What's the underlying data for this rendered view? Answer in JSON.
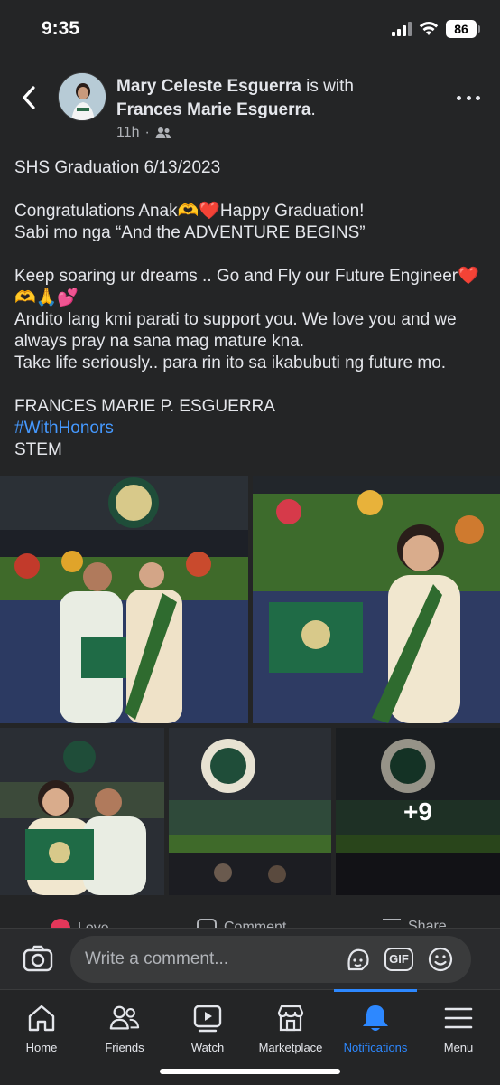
{
  "status_bar": {
    "time": "9:35",
    "battery": "86"
  },
  "post": {
    "author": "Mary Celeste Esguerra",
    "with_text": "is with",
    "tagged": "Frances Marie Esguerra",
    "tagged_suffix": ".",
    "time_ago": "11h",
    "dot": "·",
    "audience_icon": "friends-icon",
    "text": {
      "line1": "SHS Graduation 6/13/2023",
      "line2": "Congratulations Anak🫶❤️Happy Graduation!",
      "line3": "Sabi mo nga “And the ADVENTURE BEGINS”",
      "line4": "Keep soaring ur dreams .. Go and Fly our Future Engineer❤️🫶🙏💕",
      "line5": "Andito lang kmi parati to support you. We love you and we always pray na sana mag mature kna.",
      "line6": "Take life seriously.. para rin ito sa ikabubuti ng future mo.",
      "line7": "FRANCES MARIE P. ESGUERRA",
      "hashtag": "#WithHonors",
      "line8": "STEM"
    },
    "photos": {
      "more_count": "+9"
    }
  },
  "reactions": {
    "love_label": "Love",
    "comment_label": "Comment",
    "share_label": "Share"
  },
  "comment_bar": {
    "placeholder": "Write a comment...",
    "gif_label": "GIF"
  },
  "tabs": [
    {
      "label": "Home",
      "icon": "home-icon"
    },
    {
      "label": "Friends",
      "icon": "friends-icon"
    },
    {
      "label": "Watch",
      "icon": "watch-icon"
    },
    {
      "label": "Marketplace",
      "icon": "marketplace-icon"
    },
    {
      "label": "Notifications",
      "icon": "bell-icon"
    },
    {
      "label": "Menu",
      "icon": "menu-icon"
    }
  ],
  "colors": {
    "background": "#242526",
    "text": "#e4e6eb",
    "secondary_text": "#b0b3b8",
    "link": "#4599ff",
    "active_tab": "#2d88ff"
  }
}
